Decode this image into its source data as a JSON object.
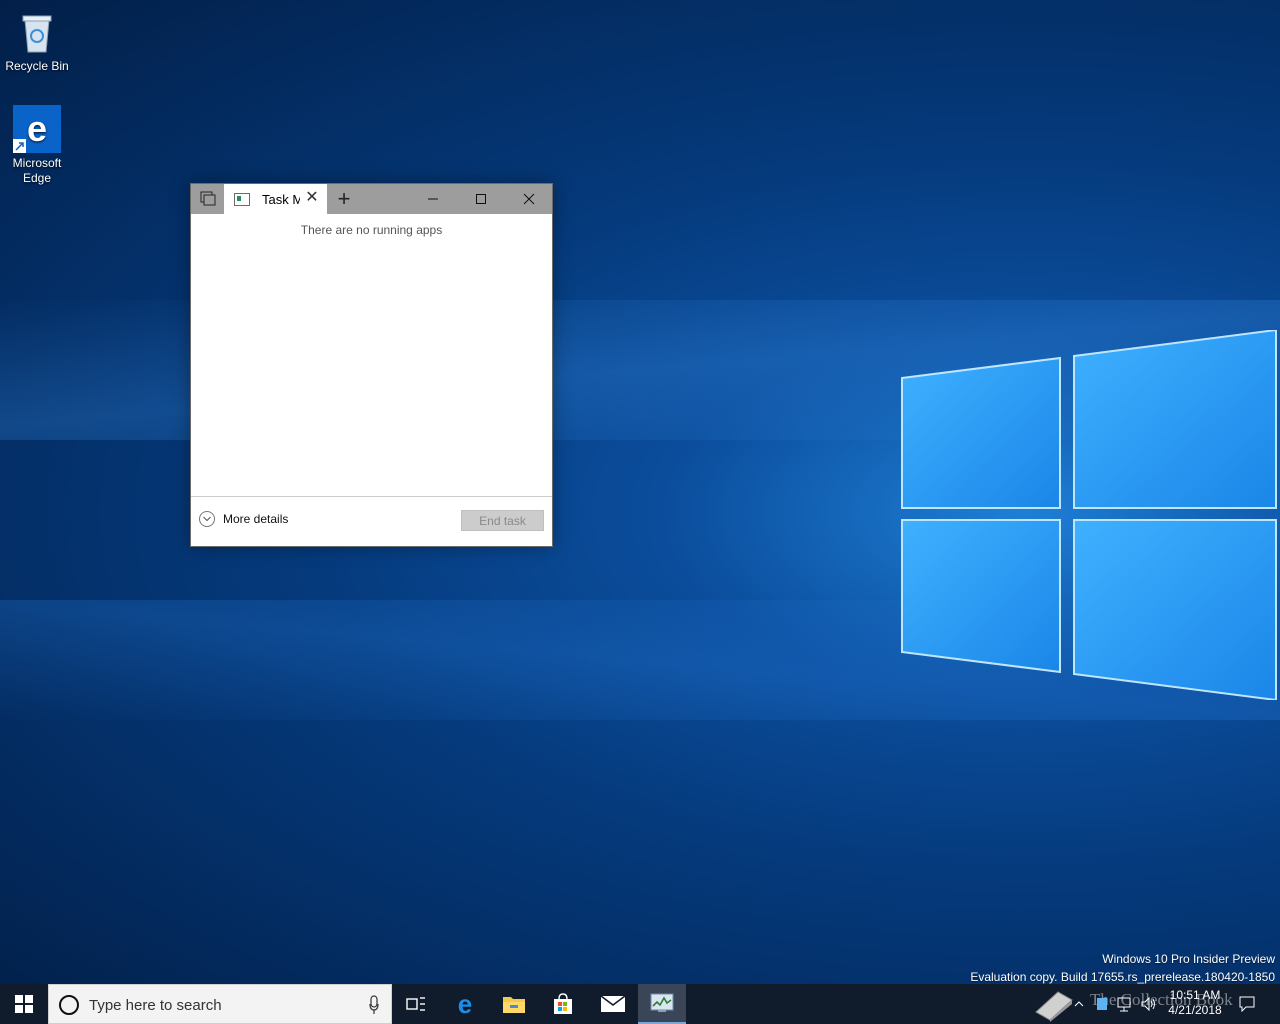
{
  "desktop": {
    "icons": [
      {
        "label": "Recycle Bin",
        "icon": "recycle-bin-icon"
      },
      {
        "label": "Microsoft Edge",
        "icon": "edge-icon"
      }
    ]
  },
  "task_manager": {
    "tab_title": "Task M",
    "empty_message": "There are no running apps",
    "more_details_label": "More details",
    "end_task_label": "End task"
  },
  "watermark": {
    "line1": "Windows 10 Pro Insider Preview",
    "line2": "Evaluation copy. Build 17655.rs_prerelease.180420-1850"
  },
  "taskbar": {
    "search_placeholder": "Type here to search",
    "apps": [
      "task-view-icon",
      "edge-icon",
      "file-explorer-icon",
      "store-icon",
      "mail-icon",
      "task-manager-icon"
    ],
    "clock_time": "10:51 AM",
    "clock_date": "4/21/2018",
    "overlay_text": "The Collection Book"
  },
  "colors": {
    "taskbar": "#101b2b",
    "accent": "#0078d7"
  }
}
